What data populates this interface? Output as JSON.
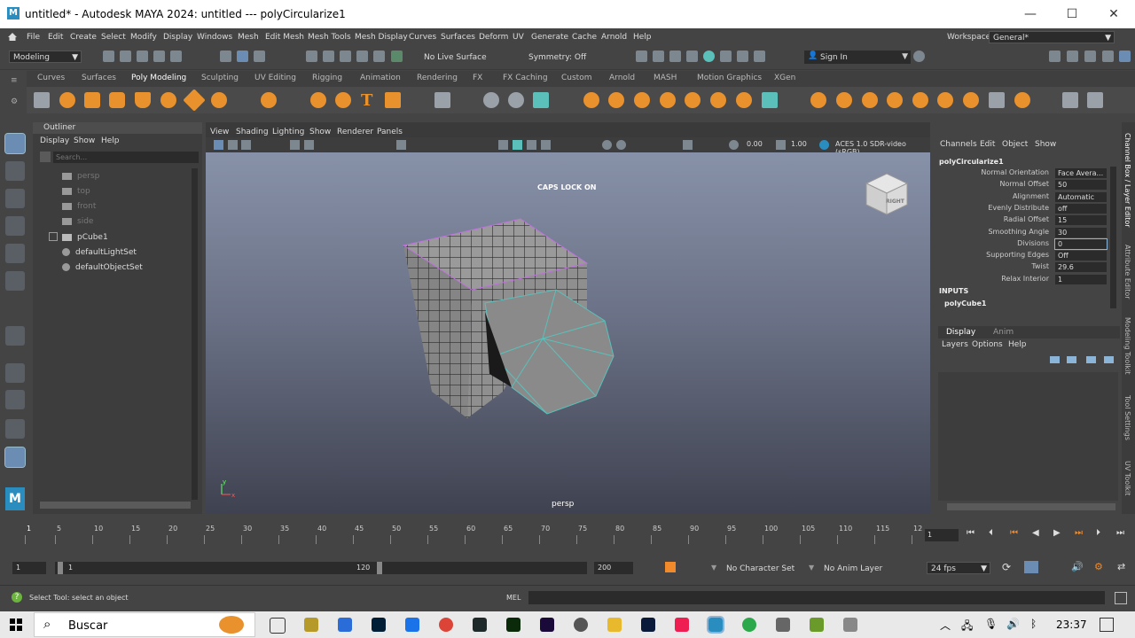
{
  "window": {
    "app_icon": "M",
    "title": "untitled* - Autodesk MAYA 2024: untitled   ---   polyCircularize1",
    "minimize": "—",
    "maximize": "☐",
    "close": "✕"
  },
  "menu": [
    "File",
    "Edit",
    "Create",
    "Select",
    "Modify",
    "Display",
    "Windows",
    "Mesh",
    "Edit Mesh",
    "Mesh Tools",
    "Mesh Display",
    "Curves",
    "Surfaces",
    "Deform",
    "UV",
    "Generate",
    "Cache",
    "Arnold",
    "Help"
  ],
  "workspace": {
    "label": "Workspace:",
    "value": "General*"
  },
  "toolbar": {
    "mode": "Modeling",
    "live_surface": "No Live Surface",
    "symmetry": "Symmetry: Off",
    "sign_in": "Sign In"
  },
  "shelf_tabs": [
    "Curves",
    "Surfaces",
    "Poly Modeling",
    "Sculpting",
    "UV Editing",
    "Rigging",
    "Animation",
    "Rendering",
    "FX",
    "FX Caching",
    "Custom",
    "Arnold",
    "MASH",
    "Motion Graphics",
    "XGen"
  ],
  "shelf_active": "Poly Modeling",
  "shelf_colors": {
    "orange": "#e8912d",
    "gray": "#9aa1a8",
    "accent": "#5bc0ba"
  },
  "outliner": {
    "title": "Outliner",
    "menu": [
      "Display",
      "Show",
      "Help"
    ],
    "search_placeholder": "Search...",
    "items": [
      {
        "label": "persp",
        "dim": true
      },
      {
        "label": "top",
        "dim": true
      },
      {
        "label": "front",
        "dim": true
      },
      {
        "label": "side",
        "dim": true
      },
      {
        "label": "pCube1",
        "dim": false
      },
      {
        "label": "defaultLightSet",
        "dim": false
      },
      {
        "label": "defaultObjectSet",
        "dim": false
      }
    ]
  },
  "viewport": {
    "menu": [
      "View",
      "Shading",
      "Lighting",
      "Show",
      "Renderer",
      "Panels"
    ],
    "value_a": "0.00",
    "value_b": "1.00",
    "color_mgmt": "ACES 1.0 SDR-video (sRGB)",
    "caps_lock": "CAPS LOCK ON",
    "camera": "persp",
    "viewcube_label": "RIGHT",
    "axis_y": "y",
    "axis_x": "x"
  },
  "channel_box": {
    "menu": [
      "Channels",
      "Edit",
      "Object",
      "Show"
    ],
    "node": "polyCircularize1",
    "attrs": [
      {
        "label": "Normal Orientation",
        "value": "Face Avera..."
      },
      {
        "label": "Normal Offset",
        "value": "50"
      },
      {
        "label": "Alignment",
        "value": "Automatic"
      },
      {
        "label": "Evenly Distribute",
        "value": "off"
      },
      {
        "label": "Radial Offset",
        "value": "15"
      },
      {
        "label": "Smoothing Angle",
        "value": "30"
      },
      {
        "label": "Divisions",
        "value": "0"
      },
      {
        "label": "Supporting Edges",
        "value": "Off"
      },
      {
        "label": "Twist",
        "value": "29.6"
      },
      {
        "label": "Relax Interior",
        "value": "1"
      }
    ],
    "inputs_label": "INPUTS",
    "input_node": "polyCube1"
  },
  "layer_editor": {
    "tabs": [
      "Display",
      "Anim"
    ],
    "menu": [
      "Layers",
      "Options",
      "Help"
    ]
  },
  "side_tabs": [
    "Channel Box / Layer Editor",
    "Attribute Editor",
    "Modeling Toolkit",
    "Tool Settings",
    "UV Toolkit"
  ],
  "timeline": {
    "ticks": [
      "1",
      "5",
      "10",
      "15",
      "20",
      "25",
      "30",
      "35",
      "40",
      "45",
      "50",
      "55",
      "60",
      "65",
      "70",
      "75",
      "80",
      "85",
      "90",
      "95",
      "100",
      "105",
      "110",
      "115",
      "12"
    ],
    "current_frame": "1"
  },
  "range": {
    "start": "1",
    "slider_start": "1",
    "slider_end": "120",
    "end": "200",
    "character_set": "No Character Set",
    "anim_layer": "No Anim Layer",
    "fps": "24 fps"
  },
  "help_line": {
    "text": "Select Tool: select an object",
    "mel": "MEL"
  },
  "taskbar": {
    "search": "Buscar",
    "time": "23:37"
  }
}
